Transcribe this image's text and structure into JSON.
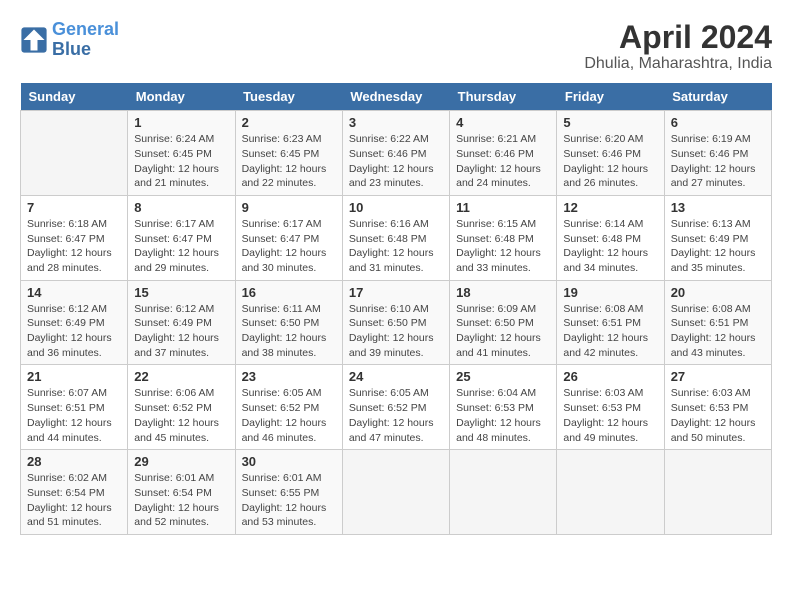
{
  "header": {
    "logo_line1": "General",
    "logo_line2": "Blue",
    "title": "April 2024",
    "subtitle": "Dhulia, Maharashtra, India"
  },
  "weekdays": [
    "Sunday",
    "Monday",
    "Tuesday",
    "Wednesday",
    "Thursday",
    "Friday",
    "Saturday"
  ],
  "weeks": [
    [
      {
        "day": "",
        "info": ""
      },
      {
        "day": "1",
        "info": "Sunrise: 6:24 AM\nSunset: 6:45 PM\nDaylight: 12 hours\nand 21 minutes."
      },
      {
        "day": "2",
        "info": "Sunrise: 6:23 AM\nSunset: 6:45 PM\nDaylight: 12 hours\nand 22 minutes."
      },
      {
        "day": "3",
        "info": "Sunrise: 6:22 AM\nSunset: 6:46 PM\nDaylight: 12 hours\nand 23 minutes."
      },
      {
        "day": "4",
        "info": "Sunrise: 6:21 AM\nSunset: 6:46 PM\nDaylight: 12 hours\nand 24 minutes."
      },
      {
        "day": "5",
        "info": "Sunrise: 6:20 AM\nSunset: 6:46 PM\nDaylight: 12 hours\nand 26 minutes."
      },
      {
        "day": "6",
        "info": "Sunrise: 6:19 AM\nSunset: 6:46 PM\nDaylight: 12 hours\nand 27 minutes."
      }
    ],
    [
      {
        "day": "7",
        "info": "Sunrise: 6:18 AM\nSunset: 6:47 PM\nDaylight: 12 hours\nand 28 minutes."
      },
      {
        "day": "8",
        "info": "Sunrise: 6:17 AM\nSunset: 6:47 PM\nDaylight: 12 hours\nand 29 minutes."
      },
      {
        "day": "9",
        "info": "Sunrise: 6:17 AM\nSunset: 6:47 PM\nDaylight: 12 hours\nand 30 minutes."
      },
      {
        "day": "10",
        "info": "Sunrise: 6:16 AM\nSunset: 6:48 PM\nDaylight: 12 hours\nand 31 minutes."
      },
      {
        "day": "11",
        "info": "Sunrise: 6:15 AM\nSunset: 6:48 PM\nDaylight: 12 hours\nand 33 minutes."
      },
      {
        "day": "12",
        "info": "Sunrise: 6:14 AM\nSunset: 6:48 PM\nDaylight: 12 hours\nand 34 minutes."
      },
      {
        "day": "13",
        "info": "Sunrise: 6:13 AM\nSunset: 6:49 PM\nDaylight: 12 hours\nand 35 minutes."
      }
    ],
    [
      {
        "day": "14",
        "info": "Sunrise: 6:12 AM\nSunset: 6:49 PM\nDaylight: 12 hours\nand 36 minutes."
      },
      {
        "day": "15",
        "info": "Sunrise: 6:12 AM\nSunset: 6:49 PM\nDaylight: 12 hours\nand 37 minutes."
      },
      {
        "day": "16",
        "info": "Sunrise: 6:11 AM\nSunset: 6:50 PM\nDaylight: 12 hours\nand 38 minutes."
      },
      {
        "day": "17",
        "info": "Sunrise: 6:10 AM\nSunset: 6:50 PM\nDaylight: 12 hours\nand 39 minutes."
      },
      {
        "day": "18",
        "info": "Sunrise: 6:09 AM\nSunset: 6:50 PM\nDaylight: 12 hours\nand 41 minutes."
      },
      {
        "day": "19",
        "info": "Sunrise: 6:08 AM\nSunset: 6:51 PM\nDaylight: 12 hours\nand 42 minutes."
      },
      {
        "day": "20",
        "info": "Sunrise: 6:08 AM\nSunset: 6:51 PM\nDaylight: 12 hours\nand 43 minutes."
      }
    ],
    [
      {
        "day": "21",
        "info": "Sunrise: 6:07 AM\nSunset: 6:51 PM\nDaylight: 12 hours\nand 44 minutes."
      },
      {
        "day": "22",
        "info": "Sunrise: 6:06 AM\nSunset: 6:52 PM\nDaylight: 12 hours\nand 45 minutes."
      },
      {
        "day": "23",
        "info": "Sunrise: 6:05 AM\nSunset: 6:52 PM\nDaylight: 12 hours\nand 46 minutes."
      },
      {
        "day": "24",
        "info": "Sunrise: 6:05 AM\nSunset: 6:52 PM\nDaylight: 12 hours\nand 47 minutes."
      },
      {
        "day": "25",
        "info": "Sunrise: 6:04 AM\nSunset: 6:53 PM\nDaylight: 12 hours\nand 48 minutes."
      },
      {
        "day": "26",
        "info": "Sunrise: 6:03 AM\nSunset: 6:53 PM\nDaylight: 12 hours\nand 49 minutes."
      },
      {
        "day": "27",
        "info": "Sunrise: 6:03 AM\nSunset: 6:53 PM\nDaylight: 12 hours\nand 50 minutes."
      }
    ],
    [
      {
        "day": "28",
        "info": "Sunrise: 6:02 AM\nSunset: 6:54 PM\nDaylight: 12 hours\nand 51 minutes."
      },
      {
        "day": "29",
        "info": "Sunrise: 6:01 AM\nSunset: 6:54 PM\nDaylight: 12 hours\nand 52 minutes."
      },
      {
        "day": "30",
        "info": "Sunrise: 6:01 AM\nSunset: 6:55 PM\nDaylight: 12 hours\nand 53 minutes."
      },
      {
        "day": "",
        "info": ""
      },
      {
        "day": "",
        "info": ""
      },
      {
        "day": "",
        "info": ""
      },
      {
        "day": "",
        "info": ""
      }
    ]
  ]
}
